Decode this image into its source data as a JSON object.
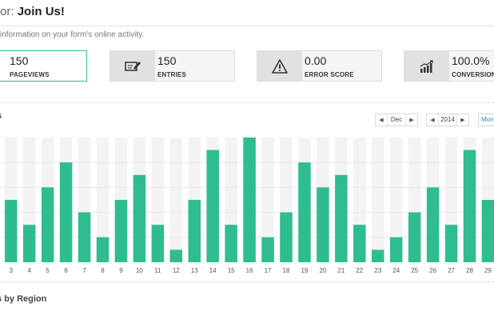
{
  "header": {
    "prefix": "or: ",
    "form_name": "Join Us!",
    "subtitle": "information on your form's online activity."
  },
  "stats": [
    {
      "value": "150",
      "label": "PAGEVIEWS",
      "icon": "eye-icon"
    },
    {
      "value": "150",
      "label": "ENTRIES",
      "icon": "entries-pen-icon"
    },
    {
      "value": "0.00",
      "label": "ERROR SCORE",
      "icon": "warning-triangle-icon"
    },
    {
      "value": "100.0%",
      "label": "CONVERSION",
      "icon": "bar-chart-trend-icon"
    }
  ],
  "chart_section": {
    "title": "s",
    "month": {
      "prev": "◀",
      "value": "Dec",
      "next": "▶"
    },
    "year": {
      "prev": "◀",
      "value": "2014",
      "next": "▶"
    },
    "period_button": "Mon"
  },
  "region_section": {
    "title": "s by Region"
  },
  "colors": {
    "accent": "#2fbc91",
    "column_bg": "#f3f3f3"
  },
  "chart_data": {
    "type": "bar",
    "categories": [
      "3",
      "4",
      "5",
      "6",
      "7",
      "8",
      "9",
      "10",
      "11",
      "12",
      "13",
      "14",
      "15",
      "16",
      "17",
      "18",
      "19",
      "20",
      "21",
      "22",
      "23",
      "24",
      "25",
      "26",
      "27",
      "28",
      "29"
    ],
    "values": [
      5,
      3,
      6,
      8,
      4,
      2,
      5,
      7,
      3,
      1,
      5,
      9,
      3,
      10,
      2,
      4,
      8,
      6,
      7,
      3,
      1,
      2,
      4,
      6,
      3,
      9,
      5
    ],
    "ylim": [
      0,
      10
    ],
    "xlabel": "",
    "ylabel": "",
    "grid": true
  }
}
